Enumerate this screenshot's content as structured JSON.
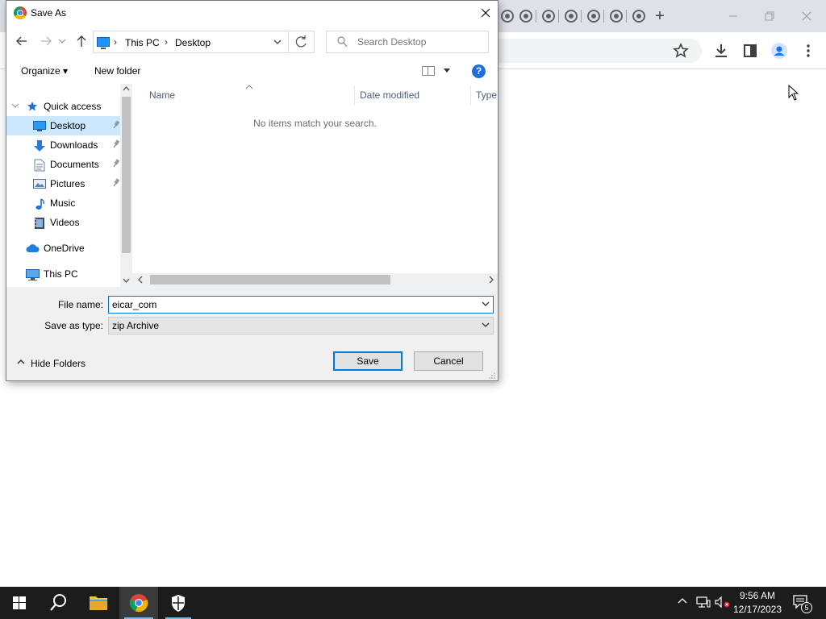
{
  "browser": {
    "tab_count": 7,
    "new_tab_glyph": "+",
    "window_controls": [
      "minimize-icon",
      "restore-icon",
      "close-icon"
    ],
    "toolbar_icons": [
      "star-icon",
      "download-icon",
      "side-panel-icon",
      "profile-icon",
      "more-icon"
    ]
  },
  "dialog": {
    "title": "Save As",
    "address": {
      "crumbs": [
        "This PC",
        "Desktop"
      ]
    },
    "search": {
      "placeholder": "Search Desktop"
    },
    "commands": {
      "organize": "Organize ▾",
      "new_folder": "New folder"
    },
    "nav_tree": [
      {
        "label": "Quick access",
        "icon": "star-icon",
        "level": 0
      },
      {
        "label": "Desktop",
        "icon": "desktop-folder-icon",
        "level": 1,
        "pinned": true,
        "selected": true
      },
      {
        "label": "Downloads",
        "icon": "downloads-folder-icon",
        "level": 1,
        "pinned": true
      },
      {
        "label": "Documents",
        "icon": "documents-folder-icon",
        "level": 1,
        "pinned": true
      },
      {
        "label": "Pictures",
        "icon": "pictures-folder-icon",
        "level": 1,
        "pinned": true
      },
      {
        "label": "Music",
        "icon": "music-folder-icon",
        "level": 1
      },
      {
        "label": "Videos",
        "icon": "videos-folder-icon",
        "level": 1
      },
      {
        "label": "OneDrive",
        "icon": "onedrive-cloud-icon",
        "level": 0
      },
      {
        "label": "This PC",
        "icon": "this-pc-icon",
        "level": 0
      }
    ],
    "columns": [
      "Name",
      "Date modified",
      "Type"
    ],
    "empty_message": "No items match your search.",
    "file_name_label": "File name:",
    "file_name_value": "eicar_com",
    "save_type_label": "Save as type:",
    "save_type_value": "zip Archive",
    "hide_folders": "Hide Folders",
    "save_button": "Save",
    "cancel_button": "Cancel"
  },
  "taskbar": {
    "apps": [
      "start-icon",
      "search-icon",
      "file-explorer-icon",
      "chrome-icon",
      "windows-security-icon"
    ],
    "time": "9:56 AM",
    "date": "12/17/2023",
    "notification_count": "5"
  },
  "colors": {
    "accent": "#0078d7",
    "selection": "#cce8ff",
    "taskbar": "#1c1c1c"
  }
}
